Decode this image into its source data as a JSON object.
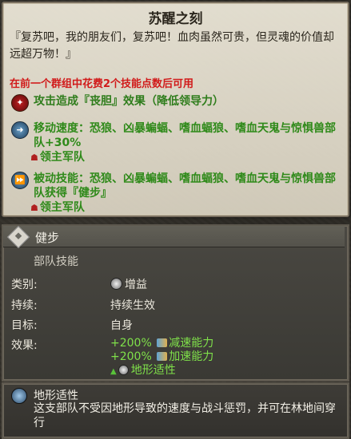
{
  "tooltip": {
    "title": "苏醒之刻",
    "quote": "『复苏吧，我的朋友们，复苏吧！血肉虽然可贵，但灵魂的价值却远超万物！』",
    "requirement": "在前一个群组中花费2个技能点数后可用",
    "effects": [
      {
        "icon": "fear-icon",
        "text": "攻击造成『丧胆』效果（降低领导力）"
      },
      {
        "icon": "speed-icon",
        "text": "移动速度：恐狼、凶暴蝙蝠、嗜血蝠狼、嗜血天鬼与惊惧兽部队+30%",
        "sub": "领主军队"
      },
      {
        "icon": "passive-icon",
        "text": "被动技能：恐狼、凶暴蝙蝠、嗜血蝠狼、嗜血天鬼与惊惧兽部队获得『健步』",
        "sub": "领主军队"
      }
    ]
  },
  "ability": {
    "name": "健步",
    "type_label": "部队技能",
    "rows": {
      "category_label": "类别:",
      "category_value": "增益",
      "duration_label": "持续:",
      "duration_value": "持续生效",
      "target_label": "目标:",
      "target_value": "自身",
      "effect_label": "效果:"
    },
    "effect_lines": [
      {
        "value": "+200%",
        "text": "减速能力"
      },
      {
        "value": "+200%",
        "text": "加速能力"
      }
    ],
    "effect_extra": "地形适性"
  },
  "footer": {
    "title": "地形适性",
    "description": "这支部队不受因地形导致的速度与战斗惩罚，并可在林地间穿行"
  },
  "colors": {
    "requirement": "#d11a1a",
    "effect_green": "#2f8a1a",
    "bonus_green": "#7fe04a"
  }
}
